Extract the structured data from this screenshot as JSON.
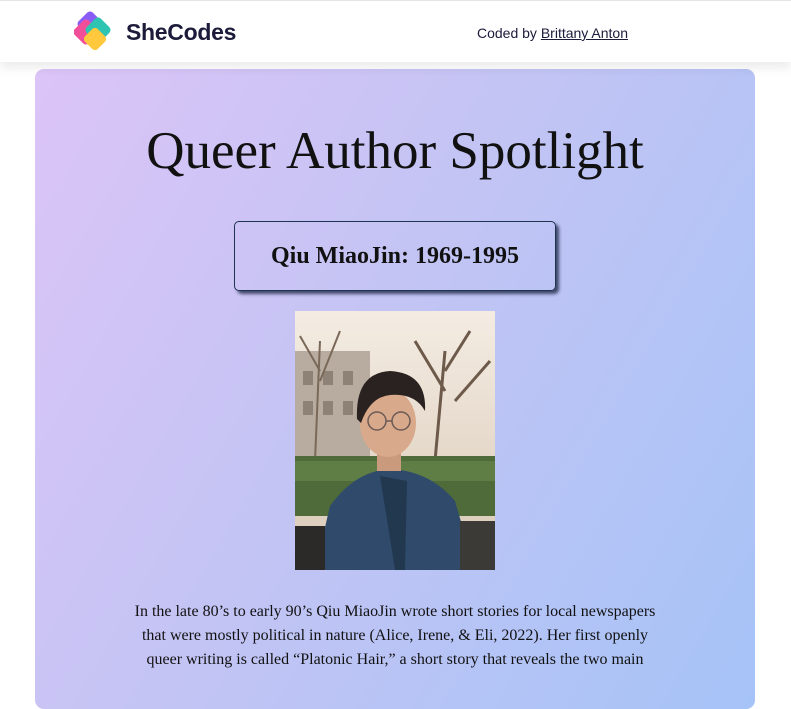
{
  "header": {
    "brand": "SheCodes",
    "credit_prefix": "Coded by",
    "credit_link": "Brittany Anton"
  },
  "main": {
    "title": "Queer Author Spotlight",
    "author_heading": "Qiu MiaoJin: 1969-1995",
    "bio": "In the late 80’s to early 90’s Qiu MiaoJin wrote short stories for local newspapers that were mostly political in nature (Alice, Irene, & Eli, 2022). Her first openly queer writing is called “Platonic Hair,” a short story that reveals the two main"
  },
  "colors": {
    "gradient_start": "#dcc4f7",
    "gradient_end": "#a6c3f7",
    "brand_text": "#1c1b3a",
    "logo_pink": "#f04e98",
    "logo_purple": "#8a5cf6",
    "logo_teal": "#2fc4b2",
    "logo_yellow": "#ffc83d"
  }
}
